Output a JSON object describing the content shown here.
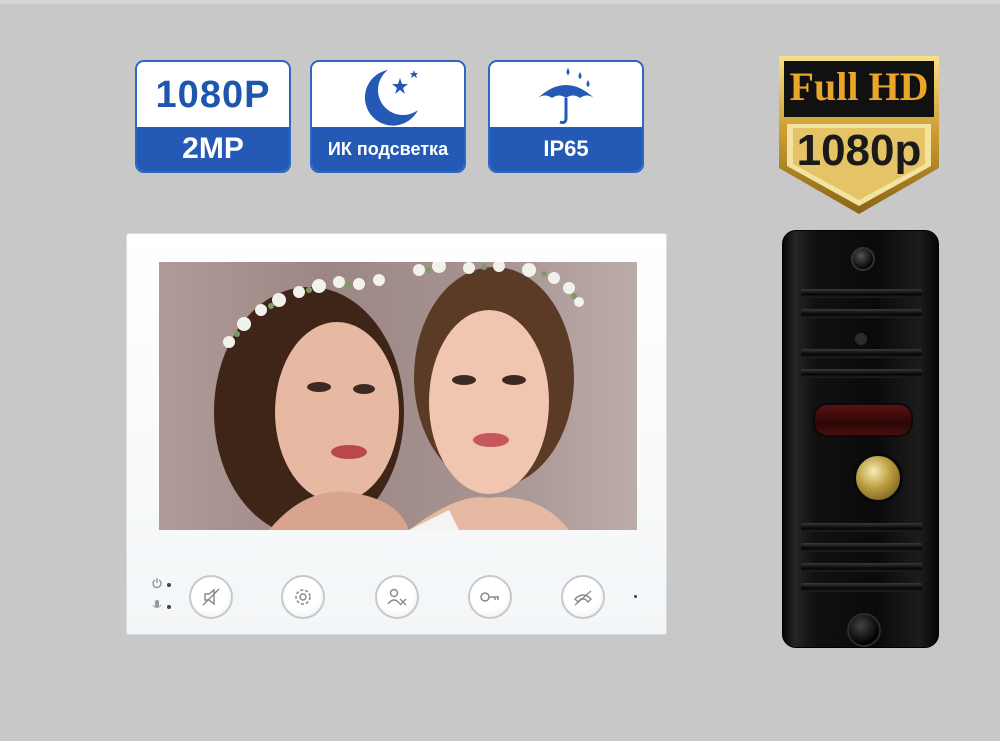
{
  "badges": {
    "resolution": {
      "top": "1080P",
      "bottom": "2MP",
      "icon": "resolution-text"
    },
    "night": {
      "bottom": "ИК подсветка",
      "icon": "moon-stars-icon"
    },
    "weather": {
      "bottom": "IP65",
      "icon": "umbrella-rain-icon"
    }
  },
  "fullhd": {
    "line1": "Full HD",
    "line2": "1080p"
  },
  "monitor": {
    "buttons": [
      "mute-icon",
      "gear-icon",
      "people-icon",
      "key-icon",
      "phone-icon"
    ],
    "indicators": [
      "power-icon",
      "mic-icon"
    ]
  },
  "colors": {
    "badge_blue": "#2459b6",
    "gold": "#eaa52b",
    "background": "#c8c8c8"
  }
}
